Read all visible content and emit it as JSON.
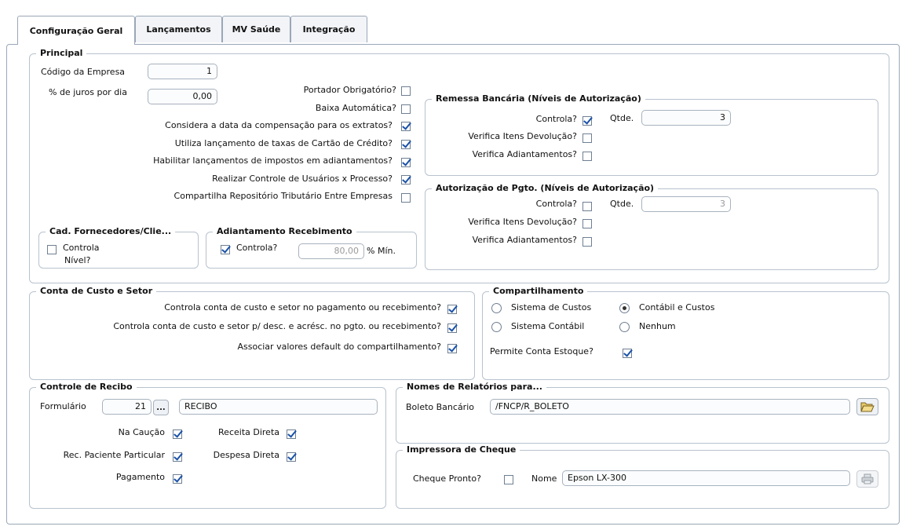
{
  "tabs": [
    "Configuração Geral",
    "Lançamentos",
    "MV Saúde",
    "Integração"
  ],
  "principal": {
    "title": "Principal",
    "codigo_label": "Código da Empresa",
    "codigo_value": "1",
    "juros_label": "% de juros por dia",
    "juros_value": "0,00",
    "portador_label": "Portador Obrigatório?",
    "baixa_label": "Baixa Automática?",
    "considera_label": "Considera a data da compensação para os extratos?",
    "utiliza_label": "Utiliza lançamento de taxas de Cartão de Crédito?",
    "habilitar_label": "Habilitar lançamentos de impostos em adiantamentos?",
    "realizar_label": "Realizar Controle de Usuários x Processo?",
    "compartilha_label": "Compartilha Repositório Tributário Entre Empresas",
    "remessa": {
      "title": "Remessa Bancária (Níveis de Autorização)",
      "controla_label": "Controla?",
      "qtde_label": "Qtde.",
      "qtde_value": "3",
      "verifica_dev_label": "Verifica Itens Devolução?",
      "verifica_adi_label": "Verifica Adiantamentos?"
    },
    "autorizacao": {
      "title": "Autorização de Pgto. (Níveis de Autorização)",
      "controla_label": "Controla?",
      "qtde_label": "Qtde.",
      "qtde_value": "3",
      "verifica_dev_label": "Verifica Itens Devolução?",
      "verifica_adi_label": "Verifica Adiantamentos?"
    },
    "cad_forn": {
      "title": "Cad. Fornecedores/Clie...",
      "controla_label_1": "Controla",
      "controla_label_2": "Nível?"
    },
    "adiantamento": {
      "title": "Adiantamento Recebimento",
      "controla_label": "Controla?",
      "min_value": "80,00",
      "min_label": "% Mín."
    }
  },
  "conta_custo": {
    "title": "Conta de Custo e Setor",
    "l1": "Controla conta de custo e setor no pagamento ou recebimento?",
    "l2": "Controla conta de custo e setor p/ desc. e acrésc. no pgto. ou recebimento?",
    "l3": "Associar valores default do compartilhamento?"
  },
  "compartilhamento": {
    "title": "Compartilhamento",
    "opt1": "Sistema de Custos",
    "opt2": "Contábil e Custos",
    "opt3": "Sistema Contábil",
    "opt4": "Nenhum",
    "selected": "Contábil e Custos",
    "permite_label": "Permite Conta Estoque?"
  },
  "recibo": {
    "title": "Controle de Recibo",
    "formulario_label": "Formulário",
    "formulario_value": "21",
    "ellipsis": "...",
    "descricao_value": "RECIBO",
    "na_caucao": "Na Caução",
    "receita_direta": "Receita Direta",
    "rec_paciente": "Rec. Paciente Particular",
    "despesa_direta": "Despesa Direta",
    "pagamento": "Pagamento"
  },
  "relatorios": {
    "title": "Nomes de Relatórios para...",
    "boleto_label": "Boleto Bancário",
    "boleto_value": "/FNCP/R_BOLETO"
  },
  "impressora": {
    "title": "Impressora de Cheque",
    "cheque_label": "Cheque Pronto?",
    "nome_label": "Nome",
    "nome_value": "Epson LX-300"
  },
  "colors": {
    "accent": "#1a52a8",
    "border": "#b8c2ce"
  },
  "icons": {
    "folder": "folder-open-icon",
    "print": "printer-icon"
  }
}
